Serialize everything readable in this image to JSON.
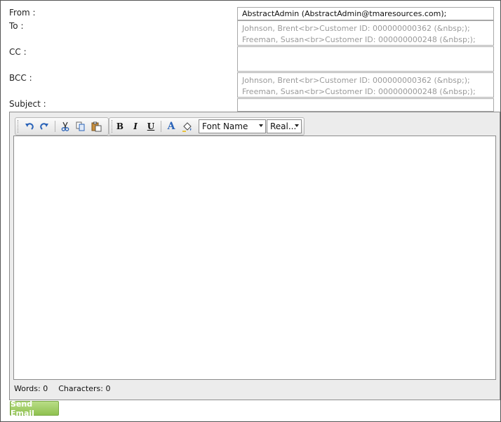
{
  "form": {
    "from_label": "From :",
    "to_label": "To :",
    "cc_label": "CC :",
    "bcc_label": "BCC :",
    "subject_label": "Subject :",
    "from_value": "AbstractAdmin (AbstractAdmin@tmaresources.com);",
    "to_placeholder_line1": "Johnson, Brent<br>Customer ID: 000000000362 (&nbsp;);",
    "to_placeholder_line2": "Freeman, Susan<br>Customer ID: 000000000248 (&nbsp;);",
    "cc_value": "",
    "bcc_placeholder_line1": "Johnson, Brent<br>Customer ID: 000000000362 (&nbsp;);",
    "bcc_placeholder_line2": "Freeman, Susan<br>Customer ID: 000000000248 (&nbsp;);",
    "subject_value": ""
  },
  "editor": {
    "font_name": "Font Name",
    "font_size": "Real...",
    "words_label": "Words: 0",
    "characters_label": "Characters: 0",
    "toolbar_icons": [
      "undo-icon",
      "redo-icon",
      "cut-icon",
      "copy-icon",
      "paste-icon",
      "bold-icon",
      "italic-icon",
      "underline-icon",
      "font-color-icon",
      "highlight-icon"
    ]
  },
  "actions": {
    "send_label": "Send Email"
  },
  "colors": {
    "send_button": "#a4cf6b",
    "icon_blue": "#2a63b8",
    "editor_bg": "#ececec"
  }
}
